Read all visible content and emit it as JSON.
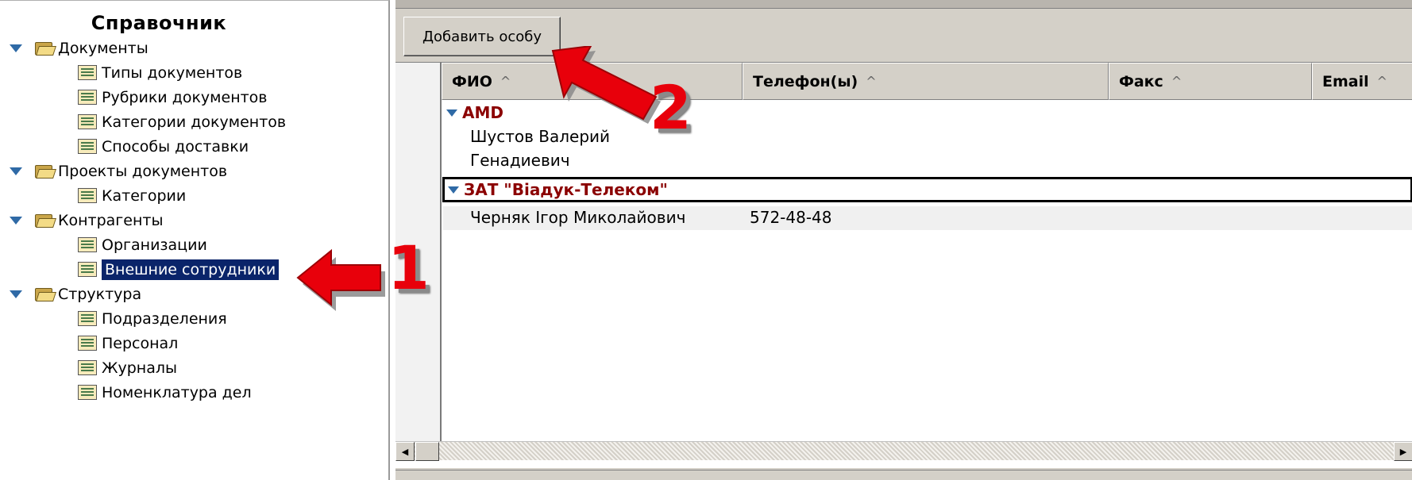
{
  "tree": {
    "title": "Справочник",
    "items": [
      {
        "kind": "group",
        "label": "Документы"
      },
      {
        "kind": "item",
        "label": "Типы документов"
      },
      {
        "kind": "item",
        "label": "Рубрики документов"
      },
      {
        "kind": "item",
        "label": "Категории документов"
      },
      {
        "kind": "item",
        "label": "Способы доставки"
      },
      {
        "kind": "group",
        "label": "Проекты документов"
      },
      {
        "kind": "item",
        "label": "Категории"
      },
      {
        "kind": "group",
        "label": "Контрагенты"
      },
      {
        "kind": "item",
        "label": "Организации"
      },
      {
        "kind": "item",
        "label": "Внешние сотрудники",
        "selected": true
      },
      {
        "kind": "group",
        "label": "Структура"
      },
      {
        "kind": "item",
        "label": "Подразделения"
      },
      {
        "kind": "item",
        "label": "Персонал"
      },
      {
        "kind": "item",
        "label": "Журналы"
      },
      {
        "kind": "item",
        "label": "Номенклатура дел"
      }
    ]
  },
  "toolbar": {
    "add_person_label": "Добавить особу"
  },
  "grid": {
    "columns": [
      {
        "label": "ФИО",
        "sort": "^"
      },
      {
        "label": "Телефон(ы)",
        "sort": "^"
      },
      {
        "label": "Факс",
        "sort": "^"
      },
      {
        "label": "Email",
        "sort": "^"
      }
    ],
    "groups": [
      {
        "name": "AMD",
        "rows": [
          {
            "fio_line1": "Шустов Валерий",
            "fio_line2": "Генадиевич",
            "phone": ""
          }
        ]
      },
      {
        "name": "ЗАТ \"Віадук-Телеком\"",
        "rows": [
          {
            "fio_line1": "Черняк Ігор Миколайович",
            "phone": "572-48-48"
          }
        ]
      }
    ]
  },
  "scrollbar": {
    "left_arrow": "◀",
    "right_arrow": "▶"
  },
  "callouts": [
    {
      "number": "1",
      "color": "#e8000b"
    },
    {
      "number": "2",
      "color": "#e8000b"
    }
  ]
}
